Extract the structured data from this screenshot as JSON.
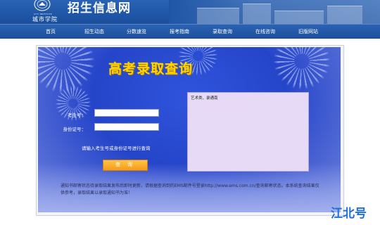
{
  "header": {
    "logo_en": "CITY INSTITUTE",
    "logo_cn": "城市学院",
    "site_title": "招生信息网"
  },
  "nav": {
    "items": [
      {
        "label": "首页"
      },
      {
        "label": "招生动态"
      },
      {
        "label": "分数速览"
      },
      {
        "label": "报考指南"
      },
      {
        "label": "录取查询"
      },
      {
        "label": "在线咨询"
      },
      {
        "label": "旧版网站"
      }
    ]
  },
  "query": {
    "title": "高考录取查询",
    "exam_no_label": "考生号：",
    "exam_no_value": "",
    "id_no_label": "身份证号：",
    "id_no_value": "",
    "hint": "请输入考生号或身份证号进行查询",
    "button_label": "查 询",
    "result_text": "艺术类、录通南",
    "notice": "通知书邮寄状态待录取结果发布后即时更新，请根据查询到的EMS邮件号登录http://www.ems.com.cn/查询邮寄状态。本系统查询结果仅供参考，录取结果以录取通知书为准！"
  },
  "watermark": "江北号",
  "colors": {
    "header_blue": "#1f56a6",
    "title_yellow": "#ffd400",
    "button_orange": "#f59a1b",
    "result_bg": "#e6daf6"
  }
}
